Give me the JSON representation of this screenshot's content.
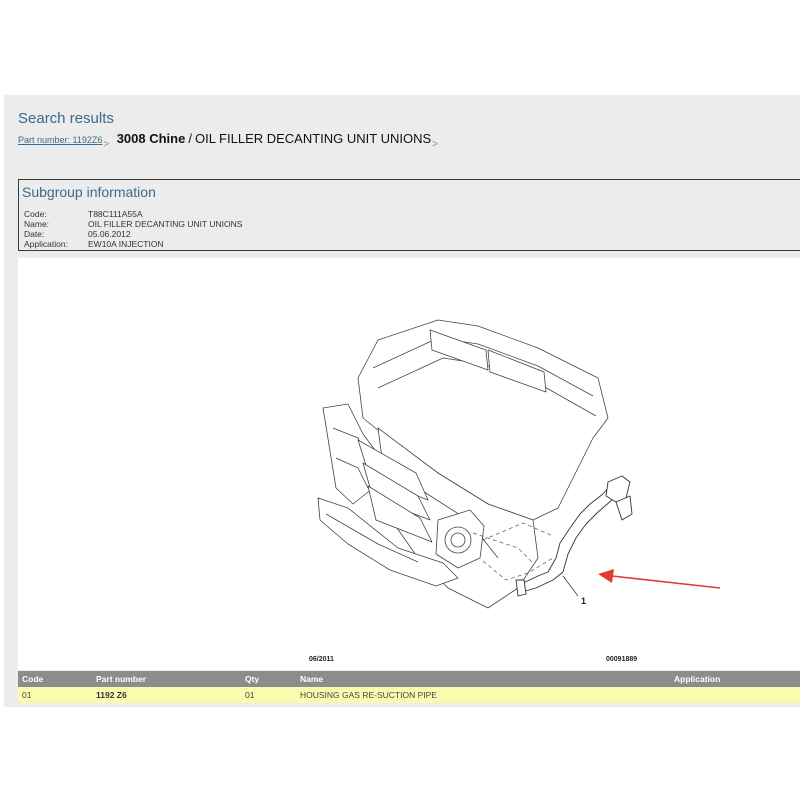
{
  "page": {
    "title": "Search results",
    "breadcrumb": {
      "part_number_link": "Part number: 1192Z6",
      "separator": ">",
      "vehicle": "3008 Chine",
      "slash": "/",
      "group": "OIL FILLER DECANTING UNIT UNIONS",
      "end_separator": ">"
    }
  },
  "subgroup": {
    "heading": "Subgroup information",
    "code_label": "Code:",
    "code_value": "T88C111A55A",
    "name_label": "Name:",
    "name_value": "OIL FILLER DECANTING UNIT UNIONS",
    "date_label": "Date:",
    "date_value": "05.06.2012",
    "application_label": "Application:",
    "application_value": "EW10A INJECTION"
  },
  "figure": {
    "date_note": "06/2011",
    "reference_note": "00091889",
    "callout": "1",
    "colors": {
      "arrow": "#e53935",
      "line": "#3a3a3a"
    }
  },
  "table": {
    "headers": {
      "code": "Code",
      "part_number": "Part number",
      "qty": "Qty",
      "name": "Name",
      "application": "Application"
    },
    "rows": [
      {
        "code": "01",
        "part_number": "1192 Z6",
        "qty": "01",
        "name": "HOUSING GAS RE-SUCTION PIPE",
        "application": ""
      }
    ],
    "colors": {
      "header_bg": "#8c8c8c",
      "row_bg": "#fbfbb0"
    }
  }
}
